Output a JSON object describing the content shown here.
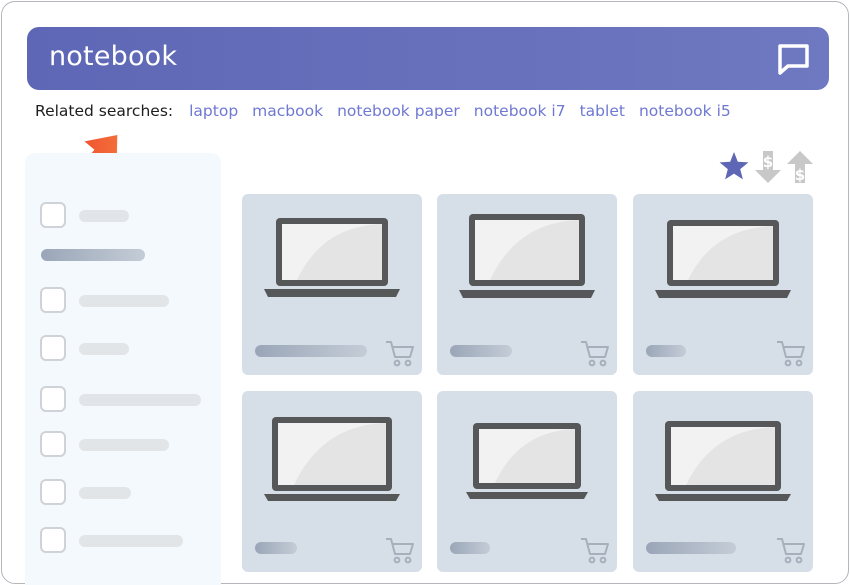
{
  "search": {
    "query": "notebook"
  },
  "related": {
    "label": "Related searches:",
    "links": [
      "laptop",
      "macbook",
      "notebook paper",
      "notebook i7",
      "tablet",
      "notebook i5"
    ]
  },
  "sort": {
    "icons": [
      "star-icon",
      "price-low-to-high-icon",
      "price-high-to-low-icon"
    ],
    "currency_symbol": "$"
  },
  "colors": {
    "search_bar": "#5d67b5",
    "link": "#6f78d2",
    "arrow": "#f05a30",
    "card": "#d6dfe8",
    "sidebar": "#f3f9fd"
  }
}
